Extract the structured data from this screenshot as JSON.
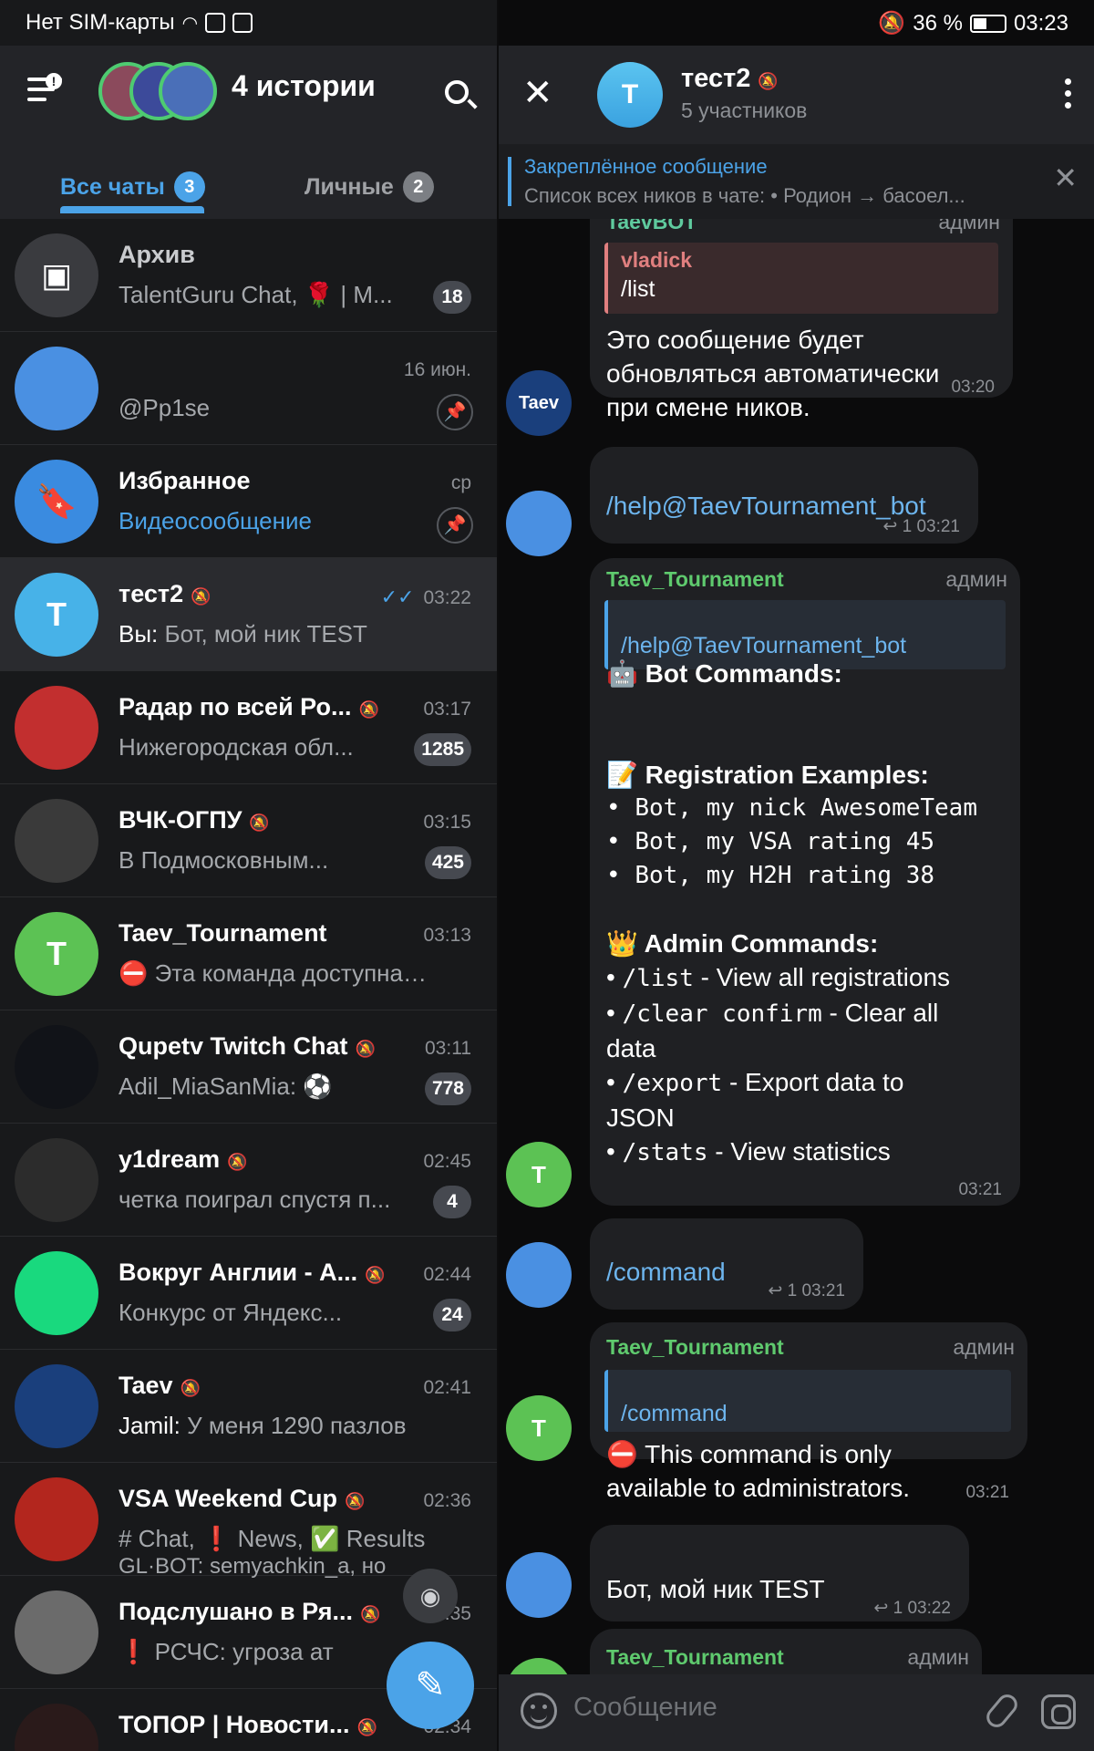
{
  "status_bar": {
    "carrier": "Нет SIM-карты",
    "battery": "36 %",
    "time": "03:23"
  },
  "left": {
    "stories_title": "4 истории",
    "tabs": [
      {
        "label": "Все чаты",
        "badge": "3"
      },
      {
        "label": "Личные",
        "badge": "2"
      }
    ],
    "chats": [
      {
        "name": "Архив",
        "time": "",
        "preview_prefix": "",
        "preview": "TalentGuru Chat, 🌹 | M...",
        "count": "18",
        "avatar_letter": "",
        "avatar_color": "#3a3b3f"
      },
      {
        "name": "",
        "time": "16 июн.",
        "preview_prefix": "",
        "preview": "@Pp1se",
        "count": "",
        "avatar_letter": "",
        "avatar_color": "#4a90e2"
      },
      {
        "name": "Избранное",
        "time": "ср",
        "preview_prefix": "",
        "preview": "Видеосообщение",
        "count": "",
        "avatar_letter": "",
        "avatar_color": "#3a8be0"
      },
      {
        "name": "тест2",
        "time": "03:22",
        "preview_prefix": "Вы:",
        "preview": "Бот, мой ник TEST",
        "count": "",
        "avatar_letter": "T",
        "avatar_color": "#47b2e8"
      },
      {
        "name": "Радар по всей Ро...",
        "time": "03:17",
        "preview_prefix": "",
        "preview": "Нижегородская обл...",
        "count": "1285",
        "avatar_letter": "",
        "avatar_color": "#c22f2f"
      },
      {
        "name": "ВЧК-ОГПУ",
        "time": "03:15",
        "preview_prefix": "",
        "preview": "В Подмосковным...",
        "count": "425",
        "avatar_letter": "",
        "avatar_color": "#3a3a3a"
      },
      {
        "name": "Taev_Tournament",
        "time": "03:13",
        "preview_prefix": "",
        "preview": "⛔ Эта команда доступна т...",
        "count": "",
        "avatar_letter": "T",
        "avatar_color": "#5cc254"
      },
      {
        "name": "Qupetv Twitch Chat",
        "time": "03:11",
        "preview_prefix": "",
        "preview": "Adil_MiaSanMia: ⚽",
        "count": "778",
        "avatar_letter": "",
        "avatar_color": "#111318"
      },
      {
        "name": "y1dream",
        "time": "02:45",
        "preview_prefix": "",
        "preview": "четка поиграл спустя п...",
        "count": "4",
        "avatar_letter": "",
        "avatar_color": "#2c2c2c"
      },
      {
        "name": "Вокруг Англии - А...",
        "time": "02:44",
        "preview_prefix": "",
        "preview": "Конкурс от Яндекс...",
        "count": "24",
        "avatar_letter": "",
        "avatar_color": "#19d97e"
      },
      {
        "name": "Taev",
        "time": "02:41",
        "preview_prefix": "Jamil:",
        "preview": "У меня 1290 пазлов",
        "count": "",
        "avatar_letter": "",
        "avatar_color": "#1a3f7c"
      },
      {
        "name": "VSA Weekend Cup",
        "time": "02:36",
        "preview_prefix": "",
        "preview": "# Chat, ❗ News, ✅ Results",
        "count": "",
        "avatar_letter": "",
        "avatar_color": "#b3261e"
      },
      {
        "name": "Подслушано в Ря...",
        "time": "02:35",
        "preview_prefix": "",
        "preview": "❗ РСЧС: угроза ат",
        "count": "",
        "avatar_letter": "",
        "avatar_color": "#6b6b6b"
      },
      {
        "name": "ТОПОР | Новости...",
        "time": "02:34",
        "preview_prefix": "",
        "preview": "",
        "count": "",
        "avatar_letter": "",
        "avatar_color": "#2a1a1a"
      }
    ],
    "vsa_extra_line": "GL·BOT: semyachkin_a, но"
  },
  "right": {
    "title": "тест2",
    "subtitle": "5 участников",
    "avatar_letter": "T",
    "pinned_title": "Закреплённое сообщение",
    "pinned_text": "Список всех ников в чате:  • Родион → басоел...",
    "composer_placeholder": "Сообщение",
    "messages": {
      "m1": {
        "sender": "TaevBOT",
        "role": "админ",
        "quote_name": "vladick",
        "quote_text": "/list",
        "text1": "Это сообщение будет",
        "text2": "обновляться автоматически",
        "text3": "при смене ников.",
        "time": "03:20"
      },
      "m2": {
        "text": "/help@TaevTournament_bot",
        "replies": "1",
        "time": "03:21"
      },
      "m3": {
        "sender": "Taev_Tournament",
        "role": "админ",
        "quote": "/help@TaevTournament_bot",
        "bot_commands": "🤖 Bot Commands:",
        "reg_examples": "📝 Registration Examples:",
        "ex1": "Bot, my nick AwesomeTeam",
        "ex2": "Bot, my VSA rating 45",
        "ex3": "Bot, my H2H rating 38",
        "admin_commands": "👑 Admin Commands:",
        "c1_cmd": "/list",
        "c1_desc": " - View all registrations",
        "c2_cmd": "/clear confirm",
        "c2_desc": " - Clear all",
        "c2_desc2": "data",
        "c3_cmd": "/export",
        "c3_desc": " - Export data to",
        "c3_desc2": "JSON",
        "c4_cmd": "/stats",
        "c4_desc": " - View statistics",
        "time": "03:21"
      },
      "m4": {
        "text": "/command",
        "replies": "1",
        "time": "03:21"
      },
      "m5": {
        "sender": "Taev_Tournament",
        "role": "админ",
        "quote": "/command",
        "text1": "⛔ This command is only",
        "text2": "available to administrators.",
        "time": "03:21"
      },
      "m6": {
        "text": "Бот, мой ник TEST",
        "replies": "1",
        "time": "03:22"
      },
      "m7": {
        "sender": "Taev_Tournament",
        "role": "админ"
      }
    },
    "colors": {
      "accent": "#4ba3e8",
      "admin_green": "#5fca6e",
      "bubble": "#1f2023"
    }
  }
}
